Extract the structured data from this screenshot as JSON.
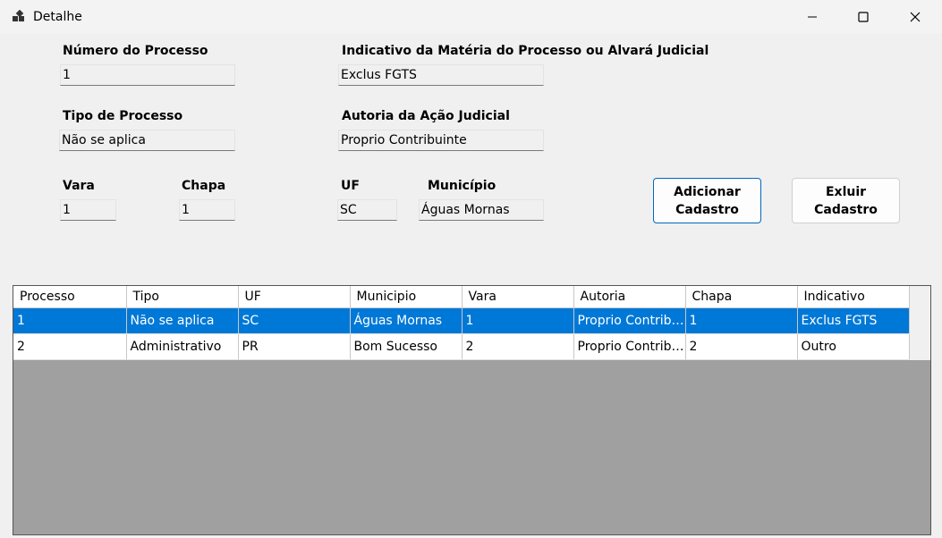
{
  "window": {
    "title": "Detalhe"
  },
  "form": {
    "numero_label": "Número do Processo",
    "numero_value": "1",
    "indicativo_label": "Indicativo da Matéria do Processo ou Alvará Judicial",
    "indicativo_value": "Exclus FGTS",
    "tipo_label": "Tipo de Processo",
    "tipo_value": "Não se aplica",
    "autoria_label": "Autoria da Ação Judicial",
    "autoria_value": "Proprio Contribuinte",
    "vara_label": "Vara",
    "vara_value": "1",
    "chapa_label": "Chapa",
    "chapa_value": "1",
    "uf_label": "UF",
    "uf_value": "SC",
    "municipio_label": "Município",
    "municipio_value": "Águas Mornas"
  },
  "buttons": {
    "adicionar": "Adicionar\nCadastro",
    "excluir": "Exluir\nCadastro"
  },
  "grid": {
    "columns": [
      "Processo",
      "Tipo",
      "UF",
      "Municipio",
      "Vara",
      "Autoria",
      "Chapa",
      "Indicativo"
    ],
    "rows": [
      [
        "1",
        "Não se aplica",
        "SC",
        "Águas Mornas",
        "1",
        "Proprio Contrib…",
        "1",
        "Exclus FGTS"
      ],
      [
        "2",
        "Administrativo",
        "PR",
        "Bom Sucesso",
        "2",
        "Proprio Contrib…",
        "2",
        "Outro"
      ]
    ],
    "selected_row": 0
  },
  "colors": {
    "selection": "#0078d7",
    "grid_background": "#a0a0a0",
    "primary_border": "#0067c0"
  }
}
